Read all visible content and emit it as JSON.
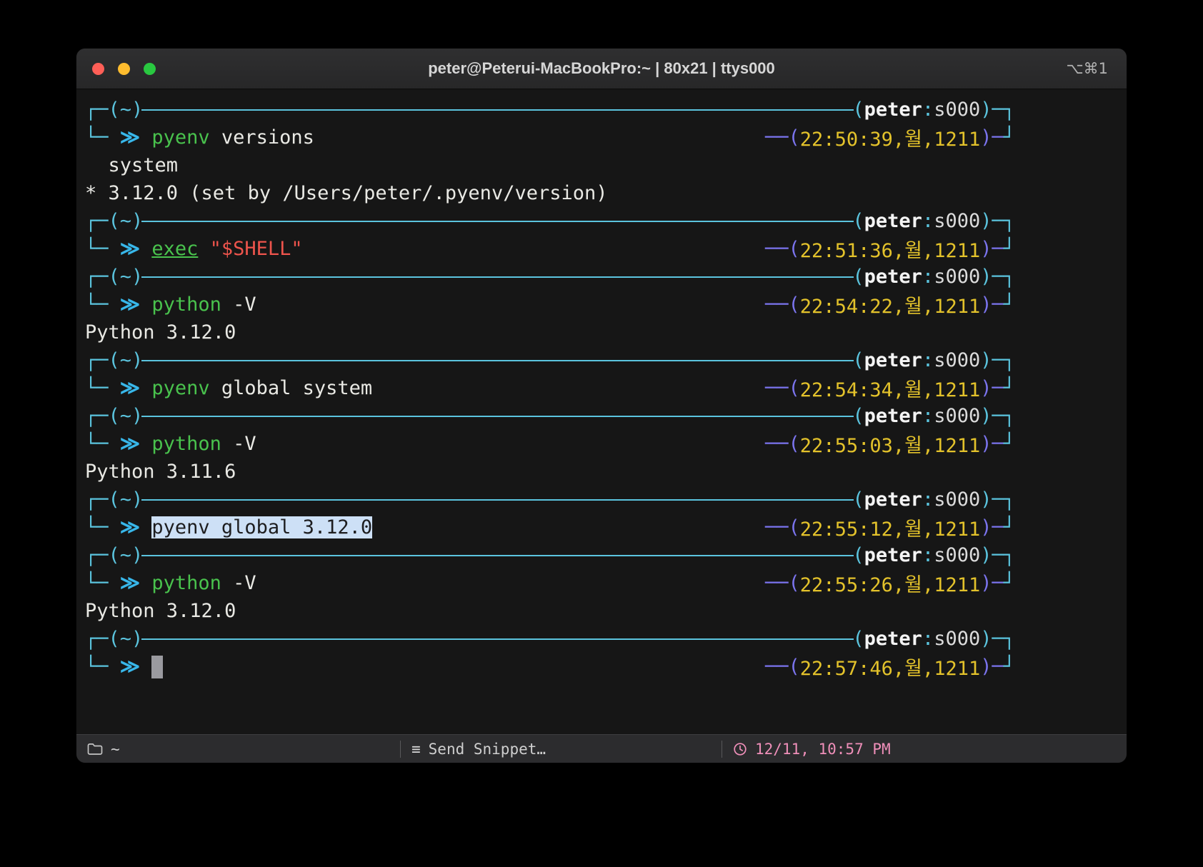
{
  "colors": {
    "line": "#5bc4de",
    "arrow": "#38b7ea",
    "cmd": "#49c24d",
    "str": "#ee544c",
    "txt": "#e9e9e4",
    "time": "#e3c22b",
    "dash": "#7b74ee",
    "user": "#f4f4f4",
    "sess": "#dcdcdc",
    "selbg": "#cde0f6",
    "seltx": "#1d1d1f",
    "cursor": "#9a9a9f",
    "term_bg": "#161616",
    "status_pink": "#ef8fb9"
  },
  "titlebar": {
    "title": "peter@Peterui-MacBookPro:~ | 80x21 | ttys000",
    "shortcut": "⌥⌘1"
  },
  "terminal": {
    "rows": [
      [
        {
          "t": "┌─",
          "c": "ln"
        },
        {
          "t": "(~)",
          "c": "cwd"
        },
        {
          "fill": true
        },
        {
          "t": "(",
          "c": "ln"
        },
        {
          "t": "peter",
          "c": "user"
        },
        {
          "t": ":",
          "c": "ln"
        },
        {
          "t": "s000",
          "c": "sess"
        },
        {
          "t": ")",
          "c": "ln"
        },
        {
          "t": "─┐",
          "c": "ln"
        }
      ],
      [
        {
          "t": "└─ ",
          "c": "ln"
        },
        {
          "t": "≫ ",
          "c": "arrow",
          "n": "prompt-arrow"
        },
        {
          "t": "pyenv",
          "c": "cmd"
        },
        {
          "t": " versions",
          "c": "txt"
        },
        {
          "spacer": true
        },
        {
          "t": "──(",
          "c": "dash"
        },
        {
          "t": "22:50:39,월,1211",
          "c": "time"
        },
        {
          "t": ")─",
          "c": "dash"
        },
        {
          "t": "┘",
          "c": "ln"
        }
      ],
      [
        {
          "t": "  system",
          "c": "txt"
        }
      ],
      [
        {
          "t": "* 3.12.0 (set by /Users/peter/.pyenv/version)",
          "c": "txt"
        }
      ],
      [
        {
          "t": "┌─",
          "c": "ln"
        },
        {
          "t": "(~)",
          "c": "cwd"
        },
        {
          "fill": true
        },
        {
          "t": "(",
          "c": "ln"
        },
        {
          "t": "peter",
          "c": "user"
        },
        {
          "t": ":",
          "c": "ln"
        },
        {
          "t": "s000",
          "c": "sess"
        },
        {
          "t": ")",
          "c": "ln"
        },
        {
          "t": "─┐",
          "c": "ln"
        }
      ],
      [
        {
          "t": "└─ ",
          "c": "ln"
        },
        {
          "t": "≫ ",
          "c": "arrow",
          "n": "prompt-arrow"
        },
        {
          "t": "exec",
          "c": "cmdu"
        },
        {
          "t": " ",
          "c": "txt"
        },
        {
          "t": "\"$SHELL\"",
          "c": "str"
        },
        {
          "spacer": true
        },
        {
          "t": "──(",
          "c": "dash"
        },
        {
          "t": "22:51:36,월,1211",
          "c": "time"
        },
        {
          "t": ")─",
          "c": "dash"
        },
        {
          "t": "┘",
          "c": "ln"
        }
      ],
      [
        {
          "t": "┌─",
          "c": "ln"
        },
        {
          "t": "(~)",
          "c": "cwd"
        },
        {
          "fill": true
        },
        {
          "t": "(",
          "c": "ln"
        },
        {
          "t": "peter",
          "c": "user"
        },
        {
          "t": ":",
          "c": "ln"
        },
        {
          "t": "s000",
          "c": "sess"
        },
        {
          "t": ")",
          "c": "ln"
        },
        {
          "t": "─┐",
          "c": "ln"
        }
      ],
      [
        {
          "t": "└─ ",
          "c": "ln"
        },
        {
          "t": "≫ ",
          "c": "arrow",
          "n": "prompt-arrow"
        },
        {
          "t": "python",
          "c": "cmd"
        },
        {
          "t": " -V",
          "c": "txt"
        },
        {
          "spacer": true
        },
        {
          "t": "──(",
          "c": "dash"
        },
        {
          "t": "22:54:22,월,1211",
          "c": "time"
        },
        {
          "t": ")─",
          "c": "dash"
        },
        {
          "t": "┘",
          "c": "ln"
        }
      ],
      [
        {
          "t": "Python 3.12.0",
          "c": "txt"
        }
      ],
      [
        {
          "t": "┌─",
          "c": "ln"
        },
        {
          "t": "(~)",
          "c": "cwd"
        },
        {
          "fill": true
        },
        {
          "t": "(",
          "c": "ln"
        },
        {
          "t": "peter",
          "c": "user"
        },
        {
          "t": ":",
          "c": "ln"
        },
        {
          "t": "s000",
          "c": "sess"
        },
        {
          "t": ")",
          "c": "ln"
        },
        {
          "t": "─┐",
          "c": "ln"
        }
      ],
      [
        {
          "t": "└─ ",
          "c": "ln"
        },
        {
          "t": "≫ ",
          "c": "arrow",
          "n": "prompt-arrow"
        },
        {
          "t": "pyenv",
          "c": "cmd"
        },
        {
          "t": " global system",
          "c": "txt"
        },
        {
          "spacer": true
        },
        {
          "t": "──(",
          "c": "dash"
        },
        {
          "t": "22:54:34,월,1211",
          "c": "time"
        },
        {
          "t": ")─",
          "c": "dash"
        },
        {
          "t": "┘",
          "c": "ln"
        }
      ],
      [
        {
          "t": "┌─",
          "c": "ln"
        },
        {
          "t": "(~)",
          "c": "cwd"
        },
        {
          "fill": true
        },
        {
          "t": "(",
          "c": "ln"
        },
        {
          "t": "peter",
          "c": "user"
        },
        {
          "t": ":",
          "c": "ln"
        },
        {
          "t": "s000",
          "c": "sess"
        },
        {
          "t": ")",
          "c": "ln"
        },
        {
          "t": "─┐",
          "c": "ln"
        }
      ],
      [
        {
          "t": "└─ ",
          "c": "ln"
        },
        {
          "t": "≫ ",
          "c": "arrow",
          "n": "prompt-arrow"
        },
        {
          "t": "python",
          "c": "cmd"
        },
        {
          "t": " -V",
          "c": "txt"
        },
        {
          "spacer": true
        },
        {
          "t": "──(",
          "c": "dash"
        },
        {
          "t": "22:55:03,월,1211",
          "c": "time"
        },
        {
          "t": ")─",
          "c": "dash"
        },
        {
          "t": "┘",
          "c": "ln"
        }
      ],
      [
        {
          "t": "Python 3.11.6",
          "c": "txt"
        }
      ],
      [
        {
          "t": "┌─",
          "c": "ln"
        },
        {
          "t": "(~)",
          "c": "cwd"
        },
        {
          "fill": true
        },
        {
          "t": "(",
          "c": "ln"
        },
        {
          "t": "peter",
          "c": "user"
        },
        {
          "t": ":",
          "c": "ln"
        },
        {
          "t": "s000",
          "c": "sess"
        },
        {
          "t": ")",
          "c": "ln"
        },
        {
          "t": "─┐",
          "c": "ln"
        }
      ],
      [
        {
          "t": "└─ ",
          "c": "ln"
        },
        {
          "t": "≫ ",
          "c": "arrow",
          "n": "prompt-arrow"
        },
        {
          "t": "pyenv global 3.12.0",
          "c": "sel",
          "n": "selected-command"
        },
        {
          "spacer": true
        },
        {
          "t": "──(",
          "c": "dash"
        },
        {
          "t": "22:55:12,월,1211",
          "c": "time"
        },
        {
          "t": ")─",
          "c": "dash"
        },
        {
          "t": "┘",
          "c": "ln"
        }
      ],
      [
        {
          "t": "┌─",
          "c": "ln"
        },
        {
          "t": "(~)",
          "c": "cwd"
        },
        {
          "fill": true
        },
        {
          "t": "(",
          "c": "ln"
        },
        {
          "t": "peter",
          "c": "user"
        },
        {
          "t": ":",
          "c": "ln"
        },
        {
          "t": "s000",
          "c": "sess"
        },
        {
          "t": ")",
          "c": "ln"
        },
        {
          "t": "─┐",
          "c": "ln"
        }
      ],
      [
        {
          "t": "└─ ",
          "c": "ln"
        },
        {
          "t": "≫ ",
          "c": "arrow",
          "n": "prompt-arrow"
        },
        {
          "t": "python",
          "c": "cmd"
        },
        {
          "t": " -V",
          "c": "txt"
        },
        {
          "spacer": true
        },
        {
          "t": "──(",
          "c": "dash"
        },
        {
          "t": "22:55:26,월,1211",
          "c": "time"
        },
        {
          "t": ")─",
          "c": "dash"
        },
        {
          "t": "┘",
          "c": "ln"
        }
      ],
      [
        {
          "t": "Python 3.12.0",
          "c": "txt"
        }
      ],
      [
        {
          "t": "┌─",
          "c": "ln"
        },
        {
          "t": "(~)",
          "c": "cwd"
        },
        {
          "fill": true
        },
        {
          "t": "(",
          "c": "ln"
        },
        {
          "t": "peter",
          "c": "user"
        },
        {
          "t": ":",
          "c": "ln"
        },
        {
          "t": "s000",
          "c": "sess"
        },
        {
          "t": ")",
          "c": "ln"
        },
        {
          "t": "─┐",
          "c": "ln"
        }
      ],
      [
        {
          "t": "└─ ",
          "c": "ln"
        },
        {
          "t": "≫ ",
          "c": "arrow",
          "n": "prompt-arrow"
        },
        {
          "cursor": true
        },
        {
          "spacer": true
        },
        {
          "t": "──(",
          "c": "dash"
        },
        {
          "t": "22:57:46,월,1211",
          "c": "time"
        },
        {
          "t": ")─",
          "c": "dash"
        },
        {
          "t": "┘",
          "c": "ln"
        }
      ]
    ]
  },
  "statusbar": {
    "path": "~",
    "menu_icon": "≡",
    "snippet": "Send Snippet…",
    "datetime": "12/11, 10:57 PM"
  }
}
